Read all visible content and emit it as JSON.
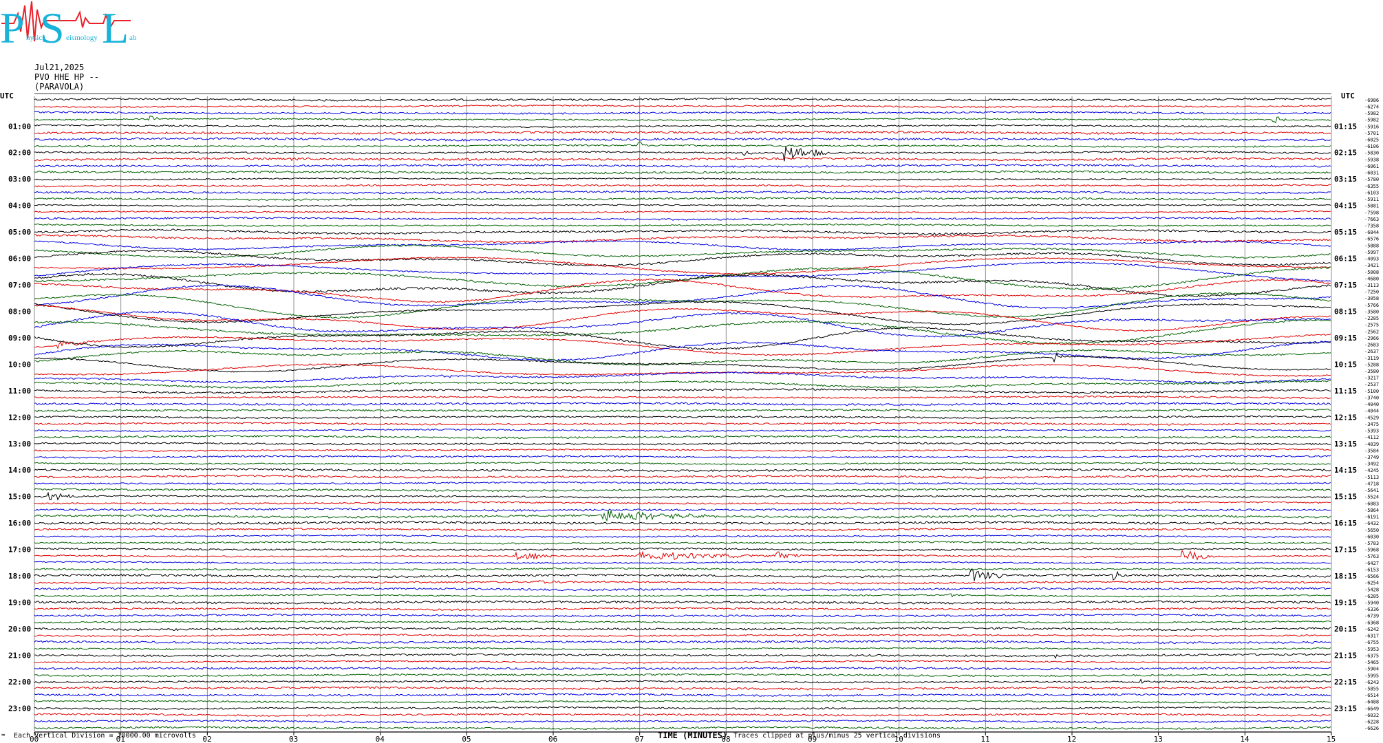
{
  "logo": {
    "letters": [
      "P",
      "S",
      "L"
    ],
    "small_words": [
      "hysics",
      "eismology",
      "ab"
    ],
    "colors": {
      "cyan": "#19b3d9",
      "red": "#e8212a"
    }
  },
  "header": {
    "date": "Jul21,2025",
    "station": "PVO HHE HP --",
    "location": "(PARAVOLA)"
  },
  "footer": {
    "left_note": "Each Vertical Division = 10000.00 microvolts",
    "xlabel": "TIME (MINUTES)",
    "clip_note": "Traces clipped at plus/minus 25 vertical divisions",
    "corner_mark": "≈"
  },
  "chart_data": {
    "type": "line",
    "title": "",
    "xlabel": "TIME (MINUTES)",
    "ylabel": "",
    "x_ticks": [
      "00",
      "01",
      "02",
      "03",
      "04",
      "05",
      "06",
      "07",
      "08",
      "09",
      "10",
      "11",
      "12",
      "13",
      "14",
      "15"
    ],
    "xlim": [
      0,
      15
    ],
    "grid": true,
    "trace_colors": [
      "#000000",
      "#e00000",
      "#0000e0",
      "#006000"
    ],
    "left_axis": {
      "header": "UTC",
      "labels": [
        "01:00",
        "02:00",
        "03:00",
        "04:00",
        "05:00",
        "06:00",
        "07:00",
        "08:00",
        "09:00",
        "10:00",
        "11:00",
        "12:00",
        "13:00",
        "14:00",
        "15:00",
        "16:00",
        "17:00",
        "18:00",
        "19:00",
        "20:00",
        "21:00",
        "22:00",
        "23:00"
      ]
    },
    "right_axis": {
      "header": "UTC",
      "labels": [
        "01:15",
        "02:15",
        "03:15",
        "04:15",
        "05:15",
        "06:15",
        "07:15",
        "08:15",
        "09:15",
        "10:15",
        "11:15",
        "12:15",
        "13:15",
        "14:15",
        "15:15",
        "16:15",
        "17:15",
        "18:15",
        "19:15",
        "20:15",
        "21:15",
        "22:15",
        "23:15"
      ]
    },
    "trace_offsets": [
      "-6986",
      "-6274",
      "-5982",
      "-5982",
      "-5916",
      "-5701",
      "-6025",
      "-6106",
      "-5830",
      "-5938",
      "-6061",
      "-6031",
      "-5780",
      "-6355",
      "-6103",
      "-5911",
      "-5881",
      "-7598",
      "-7663",
      "-7358",
      "-6844",
      "-6576",
      "-5888",
      "-5997",
      "-4093",
      "-3421",
      "-5008",
      "-4680",
      "-3113",
      "-7250",
      "-3058",
      "-5766",
      "-3580",
      "-2285",
      "-2575",
      "-2562",
      "-2966",
      "-2683",
      "-2637",
      "-3119",
      "-5288",
      "-3580",
      "-3217",
      "-2537",
      "-5100",
      "-3740",
      "-4040",
      "-4044",
      "-4529",
      "-3475",
      "-5393",
      "-4112",
      "-4039",
      "-3584",
      "-3749",
      "-3492",
      "-4245",
      "-5113",
      "-4718",
      "-5641",
      "-5524",
      "-6083",
      "-5864",
      "-6191",
      "-6432",
      "-5650",
      "-6030",
      "-5783",
      "-5968",
      "-5763",
      "-6427",
      "-6153",
      "-6566",
      "-6254",
      "-5428",
      "-6285",
      "-5940",
      "-6336",
      "-6739",
      "-6368",
      "-6242",
      "-6317",
      "-6755",
      "-5953",
      "-6375",
      "-5465",
      "-5904",
      "-5995",
      "-6243",
      "-5855",
      "-6514",
      "-6488",
      "-6649",
      "-6032",
      "-6228",
      "-6626"
    ],
    "events": [
      {
        "row": 3,
        "x": 1.35,
        "amp": 5,
        "dur": 0.1
      },
      {
        "row": 3,
        "x": 14.35,
        "amp": 6,
        "dur": 0.15
      },
      {
        "row": 7,
        "x": 7.0,
        "amp": 9,
        "dur": 0.05
      },
      {
        "row": 8,
        "x": 8.2,
        "amp": 10,
        "dur": 0.1
      },
      {
        "row": 8,
        "x": 8.7,
        "amp": 12,
        "dur": 0.5
      },
      {
        "row": 9,
        "x": 5.0,
        "amp": 6,
        "dur": 0.1
      },
      {
        "row": 9,
        "x": 3.0,
        "amp": 4,
        "dur": 0.05
      },
      {
        "row": 37,
        "x": 0.3,
        "amp": 5,
        "dur": 0.4
      },
      {
        "row": 40,
        "x": 11.8,
        "amp": 8,
        "dur": 0.1
      },
      {
        "row": 42,
        "x": 4.7,
        "amp": 3,
        "dur": 0.2
      },
      {
        "row": 60,
        "x": 0.15,
        "amp": 6,
        "dur": 0.4
      },
      {
        "row": 63,
        "x": 6.6,
        "amp": 9,
        "dur": 1.4
      },
      {
        "row": 69,
        "x": 7.0,
        "amp": 7,
        "dur": 1.6
      },
      {
        "row": 69,
        "x": 8.6,
        "amp": 6,
        "dur": 0.3
      },
      {
        "row": 69,
        "x": 5.6,
        "amp": 6,
        "dur": 0.4
      },
      {
        "row": 69,
        "x": 13.3,
        "amp": 11,
        "dur": 0.3
      },
      {
        "row": 72,
        "x": 10.85,
        "amp": 10,
        "dur": 0.4
      },
      {
        "row": 72,
        "x": 12.5,
        "amp": 6,
        "dur": 0.1
      },
      {
        "row": 73,
        "x": 5.8,
        "amp": 3,
        "dur": 0.6
      },
      {
        "row": 75,
        "x": 10.6,
        "amp": 3,
        "dur": 0.1
      },
      {
        "row": 84,
        "x": 11.8,
        "amp": 3,
        "dur": 0.05
      },
      {
        "row": 88,
        "x": 12.8,
        "amp": 3,
        "dur": 0.4
      }
    ]
  }
}
